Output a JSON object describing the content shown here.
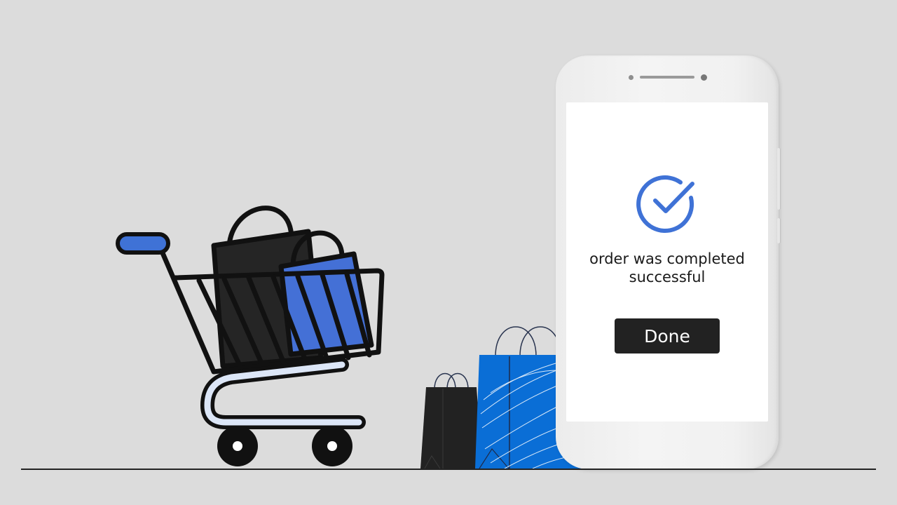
{
  "screen": {
    "status_icon": "check-circle-icon",
    "message_line1": "order was completed",
    "message_line2": "successful",
    "done_label": "Done"
  },
  "illustration": {
    "cart_icon": "shopping-cart-icon",
    "bag_icons": [
      "shopping-bag-icon",
      "shopping-bag-icon"
    ]
  },
  "colors": {
    "background": "#dcdcdc",
    "accent_blue": "#3f72d6",
    "bag_blue": "#0a6ed6",
    "dark": "#222222",
    "screen": "#ffffff"
  }
}
